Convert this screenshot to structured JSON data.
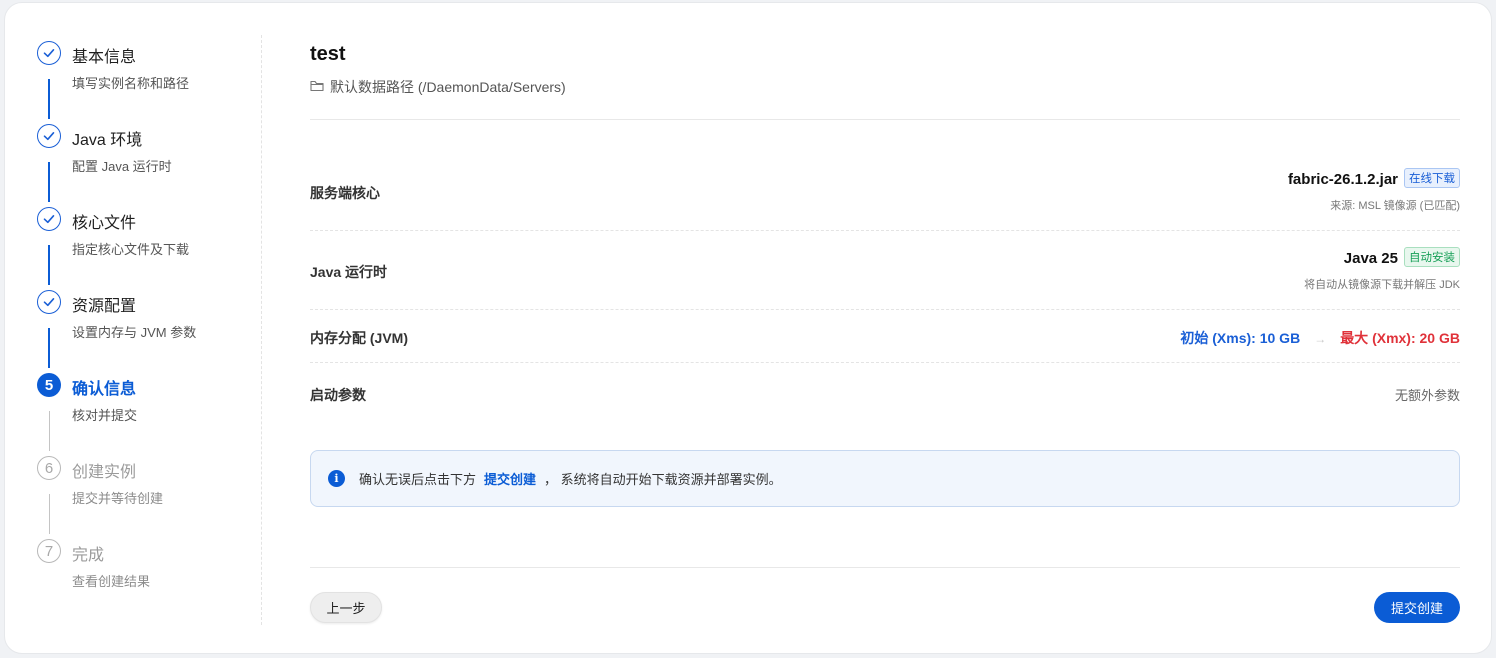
{
  "steps": [
    {
      "title": "基本信息",
      "desc": "填写实例名称和路径",
      "state": "done"
    },
    {
      "title": "Java 环境",
      "desc": "配置 Java 运行时",
      "state": "done"
    },
    {
      "title": "核心文件",
      "desc": "指定核心文件及下载",
      "state": "done"
    },
    {
      "title": "资源配置",
      "desc": "设置内存与 JVM 参数",
      "state": "done"
    },
    {
      "title": "确认信息",
      "desc": "核对并提交",
      "state": "active",
      "number": "5"
    },
    {
      "title": "创建实例",
      "desc": "提交并等待创建",
      "state": "pending",
      "number": "6"
    },
    {
      "title": "完成",
      "desc": "查看创建结果",
      "state": "pending",
      "number": "7"
    }
  ],
  "summary": {
    "instance_name": "test",
    "data_path": "默认数据路径 (/DaemonData/Servers)",
    "core": {
      "label": "服务端核心",
      "value": "fabric-26.1.2.jar",
      "tag": "在线下载",
      "sub": "来源: MSL 镜像源 (已匹配)"
    },
    "java": {
      "label": "Java 运行时",
      "value": "Java 25",
      "tag": "自动安装",
      "sub": "将自动从镜像源下载并解压 JDK"
    },
    "memory": {
      "label": "内存分配 (JVM)",
      "min": "初始 (Xms): 10 GB",
      "arrow": "→",
      "max": "最大 (Xmx): 20 GB"
    },
    "args": {
      "label": "启动参数",
      "value": "无额外参数"
    }
  },
  "notice": {
    "before": "确认无误后点击下方",
    "emphasis": "提交创建",
    "after": "，  系统将自动开始下载资源并部署实例。"
  },
  "buttons": {
    "prev": "上一步",
    "submit": "提交创建"
  },
  "colors": {
    "primary": "#0b5cd5",
    "danger": "#e0323a",
    "success": "#18a058"
  }
}
